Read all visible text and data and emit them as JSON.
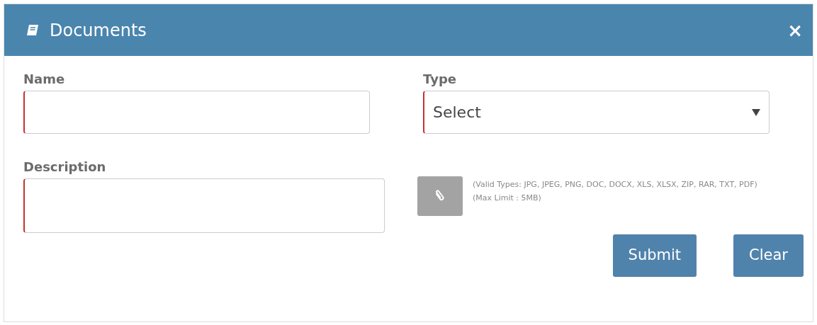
{
  "dialog": {
    "title": "Documents",
    "close": "×"
  },
  "fields": [
    {
      "kind": "text",
      "label": "Name",
      "required": true
    },
    {
      "kind": "select",
      "label": "Type",
      "value": "Select",
      "required": true
    },
    {
      "kind": "textarea",
      "label": "Description",
      "required": true
    }
  ],
  "attachment": {
    "valid_types": "(Valid Types: JPG, JPEG, PNG, DOC, DOCX, XLS, XLSX, ZIP, RAR, TXT, PDF)",
    "max_limit": "(Max Limit : 5MB)"
  },
  "buttons": [
    "Submit",
    "Clear"
  ]
}
